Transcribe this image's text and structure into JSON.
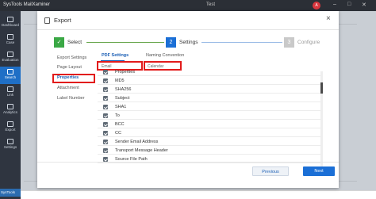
{
  "app": {
    "title": "SysTools MailXaminer",
    "doc_name": "Test",
    "avatar_initial": "A",
    "brand": "SysTools"
  },
  "sidebar": {
    "items": [
      {
        "label": "Dashboard",
        "icon": "dashboard-icon"
      },
      {
        "label": "Case",
        "icon": "case-icon"
      },
      {
        "label": "Evaluation",
        "icon": "evaluation-icon"
      },
      {
        "label": "Search",
        "icon": "search-icon",
        "active": true
      },
      {
        "label": "Link",
        "icon": "link-icon"
      },
      {
        "label": "Analytics",
        "icon": "analytics-icon"
      },
      {
        "label": "Export",
        "icon": "export-icon"
      },
      {
        "label": "Settings",
        "icon": "settings-icon"
      }
    ]
  },
  "modal": {
    "title": "Export",
    "close": "×",
    "steps": [
      {
        "num": "✓",
        "label": "Select",
        "state": "done"
      },
      {
        "num": "2",
        "label": "Settings",
        "state": "active"
      },
      {
        "num": "3",
        "label": "Configure",
        "state": "pending"
      }
    ],
    "left_nav": [
      "Export Settings",
      "Page Layout",
      "Properties",
      "Attachment",
      "Label Number"
    ],
    "left_nav_active": "Properties",
    "tabs": [
      "PDF Settings",
      "Naming Convention"
    ],
    "fields": {
      "left": "Email",
      "right": "Calendar"
    },
    "rows": [
      "Properties",
      "MD5",
      "SHA256",
      "Subject",
      "SHA1",
      "To",
      "BCC",
      "CC",
      "Sender Email Address",
      "Transport Message Header",
      "Source File Path"
    ],
    "buttons": {
      "previous": "Previous",
      "next": "Next"
    }
  },
  "colors": {
    "accent": "#1b6fd6",
    "highlight": "#e21b1b",
    "step_done": "#3aa845",
    "step_pending": "#c9c9c9"
  }
}
